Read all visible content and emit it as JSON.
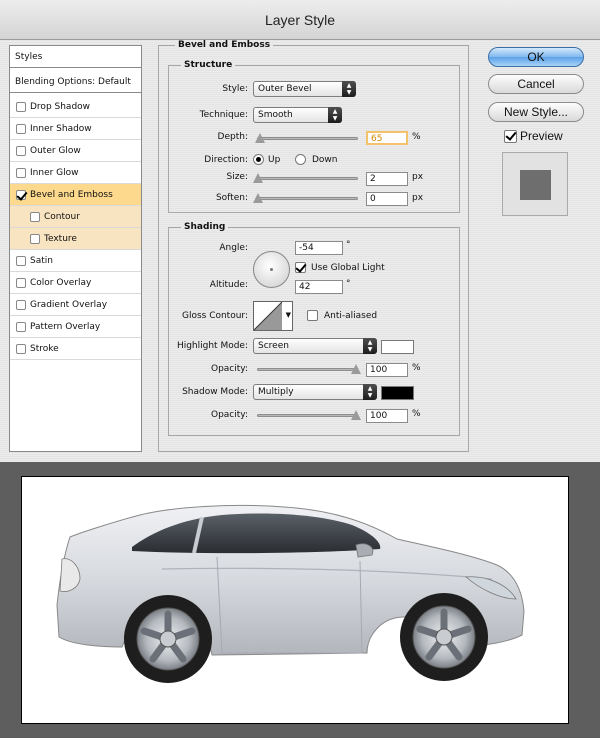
{
  "dialog": {
    "title": "Layer Style",
    "buttons": {
      "ok": "OK",
      "cancel": "Cancel",
      "new_style": "New Style...",
      "preview": "Preview"
    },
    "preview_checked": true
  },
  "styles_list": [
    {
      "label": "Styles",
      "type": "header",
      "checked": false
    },
    {
      "label": "Blending Options: Default",
      "type": "header",
      "checked": false
    },
    {
      "label": "Drop Shadow",
      "type": "item",
      "checked": false
    },
    {
      "label": "Inner Shadow",
      "type": "item",
      "checked": false
    },
    {
      "label": "Outer Glow",
      "type": "item",
      "checked": false
    },
    {
      "label": "Inner Glow",
      "type": "item",
      "checked": false
    },
    {
      "label": "Bevel and Emboss",
      "type": "item",
      "checked": true,
      "selected": true
    },
    {
      "label": "Contour",
      "type": "sub",
      "checked": false
    },
    {
      "label": "Texture",
      "type": "sub",
      "checked": false
    },
    {
      "label": "Satin",
      "type": "item",
      "checked": false
    },
    {
      "label": "Color Overlay",
      "type": "item",
      "checked": false
    },
    {
      "label": "Gradient Overlay",
      "type": "item",
      "checked": false
    },
    {
      "label": "Pattern Overlay",
      "type": "item",
      "checked": false
    },
    {
      "label": "Stroke",
      "type": "item",
      "checked": false
    }
  ],
  "bevel": {
    "section_title": "Bevel and Emboss",
    "structure": {
      "title": "Structure",
      "style_label": "Style:",
      "style_value": "Outer Bevel",
      "technique_label": "Technique:",
      "technique_value": "Smooth",
      "depth_label": "Depth:",
      "depth_value": "65",
      "depth_unit": "%",
      "depth_level": 0.02,
      "direction_label": "Direction:",
      "direction_up": "Up",
      "direction_down": "Down",
      "size_label": "Size:",
      "size_value": "2",
      "size_unit": "px",
      "size_level": 0.0,
      "soften_label": "Soften:",
      "soften_value": "0",
      "soften_unit": "px",
      "soften_level": 0.0
    },
    "shading": {
      "title": "Shading",
      "angle_label": "Angle:",
      "angle_value": "-54",
      "angle_unit": "°",
      "global_light_label": "Use Global Light",
      "global_light_checked": true,
      "altitude_label": "Altitude:",
      "altitude_value": "42",
      "altitude_unit": "°",
      "gloss_label": "Gloss Contour:",
      "anti_aliased_label": "Anti-aliased",
      "highlight_mode_label": "Highlight Mode:",
      "highlight_mode_value": "Screen",
      "highlight_color": "#ffffff",
      "highlight_opacity_label": "Opacity:",
      "highlight_opacity_value": "100",
      "highlight_opacity_unit": "%",
      "shadow_mode_label": "Shadow Mode:",
      "shadow_mode_value": "Multiply",
      "shadow_color": "#000000",
      "shadow_opacity_label": "Opacity:",
      "shadow_opacity_value": "100",
      "shadow_opacity_unit": "%"
    }
  },
  "colors": {
    "selected_row": "#fcd98c",
    "sub_row": "#f9e4c2",
    "car_body": "#d8dbe0"
  }
}
